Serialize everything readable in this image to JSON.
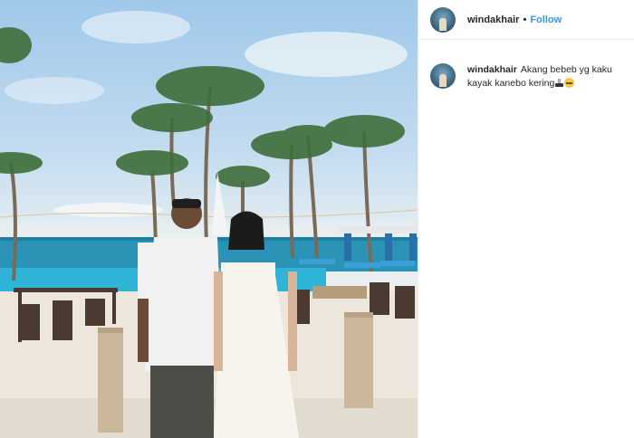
{
  "post": {
    "username": "windakhair",
    "separator": "•",
    "follow_label": "Follow"
  },
  "comment": {
    "username": "windakhair",
    "text": "Akang bebeb yg kaku kayak kanebo kering",
    "emojis": [
      "nose-icon",
      "expressionless-face-icon"
    ]
  },
  "image": {
    "description_icon": "photo",
    "colors": {
      "sky": "#9fc8ea",
      "sea": "#2a93b6",
      "pool": "#2fb3d6",
      "sand": "#ece6dc"
    }
  }
}
